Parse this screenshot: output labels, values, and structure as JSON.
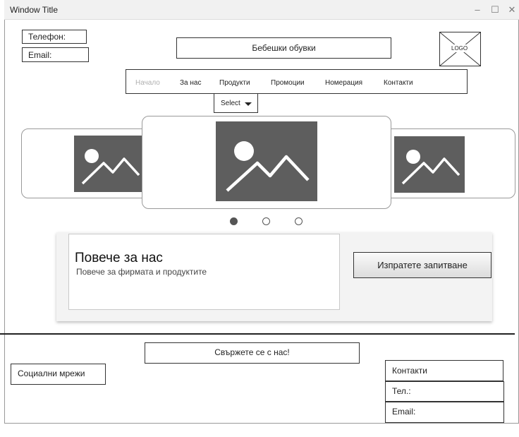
{
  "window": {
    "title": "Window Title",
    "minimize_glyph": "–",
    "maximize_glyph": "☐",
    "close_glyph": "✕"
  },
  "header": {
    "phone_label": "Телефон:",
    "email_label": "Email:",
    "site_title": "Бебешки обувки",
    "logo_text": "LOGO"
  },
  "nav": {
    "items": [
      {
        "label": "Начало",
        "active": false
      },
      {
        "label": "За нас",
        "active": true
      },
      {
        "label": "Продукти",
        "active": true
      },
      {
        "label": "Промоции",
        "active": true
      },
      {
        "label": "Номерация",
        "active": true
      },
      {
        "label": "Контакти",
        "active": true
      }
    ],
    "select_label": "Select"
  },
  "carousel": {
    "slide_icons": [
      "image-placeholder-icon",
      "image-placeholder-icon",
      "image-placeholder-icon"
    ],
    "active_dot": 0,
    "dot_count": 3
  },
  "about": {
    "heading": "Повече за нас",
    "subtitle": "Повече за фирмата и продуктите",
    "button_label": "Изпратете запитване"
  },
  "footer": {
    "contact_us": "Свържете се с нас!",
    "social": "Социални мрежи",
    "contacts_title": "Контакти",
    "phone": "Тел.:",
    "email": "Email:"
  },
  "colors": {
    "image_placeholder": "#5e5e5e",
    "inactive_nav": "#b0b0b0"
  }
}
